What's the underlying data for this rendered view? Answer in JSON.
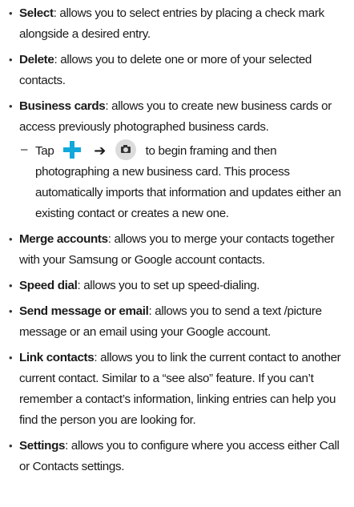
{
  "items": [
    {
      "term": "Select",
      "desc": ": allows you to select entries by placing a check mark alongside a desired entry."
    },
    {
      "term": "Delete",
      "desc": ": allows you to delete one or more of your selected contacts."
    },
    {
      "term": "Business cards",
      "desc": ": allows you to create new business cards or access previously photographed business cards."
    },
    {
      "term": "Merge accounts",
      "desc": ": allows you to merge your contacts together with your Samsung or Google account contacts."
    },
    {
      "term": "Speed dial",
      "desc": ": allows you to set up speed-dialing."
    },
    {
      "term": "Send message or email",
      "desc": ": allows you to send a text /picture message or an email using your Google account."
    },
    {
      "term": "Link contacts",
      "desc": ": allows you to link the current contact to another current contact. Similar to a “see also” feature. If you can’t remember a contact’s information, linking entries can help you find the person you are looking for."
    },
    {
      "term": "Settings",
      "desc": ": allows you to configure where you access either Call or Contacts settings."
    }
  ],
  "business_sub": {
    "prefix": "Tap",
    "suffix": "to begin framing and then photographing a new business card. This process automatically imports that information and updates either an existing contact or creates a new one."
  },
  "icons": {
    "plus": "plus-icon",
    "arrow": "arrow-icon",
    "camera": "camera-icon"
  },
  "colors": {
    "plus_icon": "#12a8dc",
    "camera_bg": "#dcdcdc"
  }
}
